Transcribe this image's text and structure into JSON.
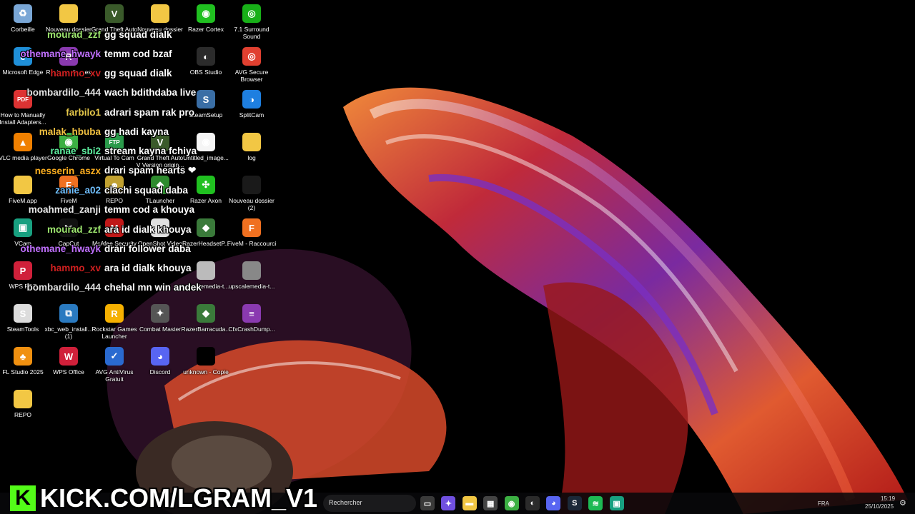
{
  "desktop_icons": [
    {
      "label": "Corbeille",
      "icon": "recycle-bin-icon",
      "color": "#7aa7d6",
      "glyph": "♻"
    },
    {
      "label": "Nouveau dossier",
      "icon": "folder-icon",
      "color": "#f2c744",
      "glyph": ""
    },
    {
      "label": "Grand Theft Auto",
      "icon": "gta-icon",
      "color": "#3a5a2a",
      "glyph": "V"
    },
    {
      "label": "Nouveau dossier",
      "icon": "folder-icon",
      "color": "#f2c744",
      "glyph": ""
    },
    {
      "label": "Razer Cortex",
      "icon": "razer-cortex-icon",
      "color": "#20c020",
      "glyph": "◉"
    },
    {
      "label": "7.1 Surround Sound",
      "icon": "surround-sound-icon",
      "color": "#18b018",
      "glyph": "◎"
    },
    {
      "label": "Microsoft Edge",
      "icon": "edge-icon",
      "color": "#1f8fd8",
      "glyph": "e"
    },
    {
      "label": "Rockstar Games",
      "icon": "winrar-icon",
      "color": "#8a3ab0",
      "glyph": "R"
    },
    {
      "label": "OBS Studio",
      "icon": "obs-icon",
      "color": "#2b2b2b",
      "glyph": "◐"
    },
    {
      "label": "AVG Secure Browser",
      "icon": "avg-browser-icon",
      "color": "#e04030",
      "glyph": "◎"
    },
    {
      "label": "How to Manually Install Adapters...",
      "icon": "pdf-icon",
      "color": "#d33",
      "glyph": "PDF"
    },
    {
      "label": "SteamSetup",
      "icon": "steam-setup-icon",
      "color": "#3a6ea5",
      "glyph": "S"
    },
    {
      "label": "SplitCam",
      "icon": "splitcam-icon",
      "color": "#1e7fe0",
      "glyph": "◑"
    },
    {
      "label": "VLC media player",
      "icon": "vlc-icon",
      "color": "#f08000",
      "glyph": "▲"
    },
    {
      "label": "Google Chrome",
      "icon": "chrome-icon",
      "color": "#3cb043",
      "glyph": "◉"
    },
    {
      "label": "Virtual To Cam",
      "icon": "ftp-icon",
      "color": "#2a9a4a",
      "glyph": "FTP"
    },
    {
      "label": "Grand Theft Auto V Version origin...",
      "icon": "gta-icon",
      "color": "#3a5a2a",
      "glyph": "V"
    },
    {
      "label": "Untitled_image...",
      "icon": "chrome-file-icon",
      "color": "#f5f5f5",
      "glyph": "◉"
    },
    {
      "label": "log",
      "icon": "folder-icon",
      "color": "#f2c744",
      "glyph": ""
    },
    {
      "label": "FiveM.app",
      "icon": "folder-icon",
      "color": "#f2c744",
      "glyph": ""
    },
    {
      "label": "FiveM",
      "icon": "fivem-icon",
      "color": "#f07020",
      "glyph": "F"
    },
    {
      "label": "REPO",
      "icon": "repo-icon",
      "color": "#c0a030",
      "glyph": "☻"
    },
    {
      "label": "TLauncher",
      "icon": "tlauncher-icon",
      "color": "#2e8b2e",
      "glyph": "◆"
    },
    {
      "label": "Razer Axon",
      "icon": "razer-axon-icon",
      "color": "#20c020",
      "glyph": "✣"
    },
    {
      "label": "Nouveau dossier (2)",
      "icon": "folder-icon",
      "color": "#1a1a1a",
      "glyph": ""
    },
    {
      "label": "VCam",
      "icon": "vcam-icon",
      "color": "#18a080",
      "glyph": "▣"
    },
    {
      "label": "CapCut",
      "icon": "capcut-icon",
      "color": "#111",
      "glyph": "✂"
    },
    {
      "label": "McAfee Security",
      "icon": "mcafee-icon",
      "color": "#c01818",
      "glyph": "M"
    },
    {
      "label": "OpenShot Video",
      "icon": "openshot-icon",
      "color": "#e0e0e0",
      "glyph": "◐"
    },
    {
      "label": "RazerHeadsetP...",
      "icon": "razer-headset-icon",
      "color": "#3a7a3a",
      "glyph": "◆"
    },
    {
      "label": "FiveM - Raccourci",
      "icon": "fivem-shortcut-icon",
      "color": "#f07020",
      "glyph": "F"
    },
    {
      "label": "WPS PDF",
      "icon": "wps-pdf-icon",
      "color": "#d0203a",
      "glyph": "P"
    },
    {
      "label": "upscalemedia-t...",
      "icon": "image-file-icon",
      "color": "#bbb",
      "glyph": ""
    },
    {
      "label": "upscalemedia-t...",
      "icon": "image-file-icon",
      "color": "#888",
      "glyph": ""
    },
    {
      "label": "SteamTools",
      "icon": "steamtools-icon",
      "color": "#dcdcdc",
      "glyph": "S"
    },
    {
      "label": "xbc_web_install... (1)",
      "icon": "xbc-install-icon",
      "color": "#2a7ac0",
      "glyph": "⧉"
    },
    {
      "label": "Rockstar Games Launcher",
      "icon": "rockstar-icon",
      "color": "#f5b000",
      "glyph": "R"
    },
    {
      "label": "Combat Master",
      "icon": "combat-master-icon",
      "color": "#555",
      "glyph": "✦"
    },
    {
      "label": "RazerBarracuda...",
      "icon": "razer-barracuda-icon",
      "color": "#3a7a3a",
      "glyph": "◆"
    },
    {
      "label": "CfxCrashDump...",
      "icon": "winrar-icon",
      "color": "#8a3ab0",
      "glyph": "≡"
    },
    {
      "label": "FL Studio 2025",
      "icon": "fl-studio-icon",
      "color": "#f09010",
      "glyph": "♣"
    },
    {
      "label": "WPS Office",
      "icon": "wps-office-icon",
      "color": "#d0203a",
      "glyph": "W"
    },
    {
      "label": "AVG AntiVirus Gratuit",
      "icon": "avg-antivirus-icon",
      "color": "#2a6ad0",
      "glyph": "✓"
    },
    {
      "label": "Discord",
      "icon": "discord-icon",
      "color": "#5865f2",
      "glyph": "◕"
    },
    {
      "label": "unknown - Copie",
      "icon": "blank-file-icon",
      "color": "#000",
      "glyph": ""
    },
    {
      "label": "REPO",
      "icon": "folder-icon",
      "color": "#f2c744",
      "glyph": ""
    }
  ],
  "chat": [
    {
      "user": "mourad_zzf",
      "color": "#9fe870",
      "msg": "gg squad dialk"
    },
    {
      "user": "othemane_hwayk",
      "color": "#c070ff",
      "msg": "temm cod bzaf"
    },
    {
      "user": "hammo_xv",
      "color": "#d02020",
      "msg": "gg squad dialk"
    },
    {
      "user": "bombardilo_444",
      "color": "#e0e0e0",
      "msg": "wach bdithdaba live"
    },
    {
      "user": "farbilo1",
      "color": "#e6c84a",
      "msg": "adrari spam rak pro"
    },
    {
      "user": "malak_hbuba",
      "color": "#f0c040",
      "msg": "gg hadi kayna"
    },
    {
      "user": "ranae_sbi2",
      "color": "#5ef0a0",
      "msg": "stream kayna fchiya"
    },
    {
      "user": "nesserin_aszx",
      "color": "#ffb020",
      "msg": "drari spam hearts ❤"
    },
    {
      "user": "zanie_a02",
      "color": "#70c0ff",
      "msg": "clachi squad daba"
    },
    {
      "user": "moahmed_zanji",
      "color": "#e8e8e8",
      "msg": "temm cod a khouya"
    },
    {
      "user": "mourad_zzf",
      "color": "#9fe870",
      "msg": "ara id dialk khouya"
    },
    {
      "user": "othemane_hwayk",
      "color": "#c070ff",
      "msg": "drari follower daba"
    },
    {
      "user": "hammo_xv",
      "color": "#d02020",
      "msg": "ara id dialk khouya"
    },
    {
      "user": "bombardilo_444",
      "color": "#e0e0e0",
      "msg": "chehal mn win andek"
    }
  ],
  "taskbar": {
    "search_placeholder": "Rechercher",
    "apps": [
      {
        "icon": "task-view-icon",
        "color": "#3a3a3a",
        "glyph": "▭"
      },
      {
        "icon": "copilot-icon",
        "color": "#7050e0",
        "glyph": "✦"
      },
      {
        "icon": "file-explorer-icon",
        "color": "#f2c744",
        "glyph": "▬"
      },
      {
        "icon": "microsoft-store-icon",
        "color": "#444",
        "glyph": "▦"
      },
      {
        "icon": "chrome-taskbar-icon",
        "color": "#3cb043",
        "glyph": "◉"
      },
      {
        "icon": "obs-taskbar-icon",
        "color": "#2b2b2b",
        "glyph": "◐"
      },
      {
        "icon": "discord-taskbar-icon",
        "color": "#5865f2",
        "glyph": "◕"
      },
      {
        "icon": "steam-taskbar-icon",
        "color": "#1b2838",
        "glyph": "S"
      },
      {
        "icon": "spotify-icon",
        "color": "#1db954",
        "glyph": "≋"
      },
      {
        "icon": "vcam-taskbar-icon",
        "color": "#18a080",
        "glyph": "▣"
      }
    ],
    "language": "FRA",
    "time": "15:19",
    "date": "25/10/2025"
  },
  "watermark": {
    "text": "KICK.COM/LGRAM_V1",
    "badge": "K",
    "color": "#53fc18"
  }
}
